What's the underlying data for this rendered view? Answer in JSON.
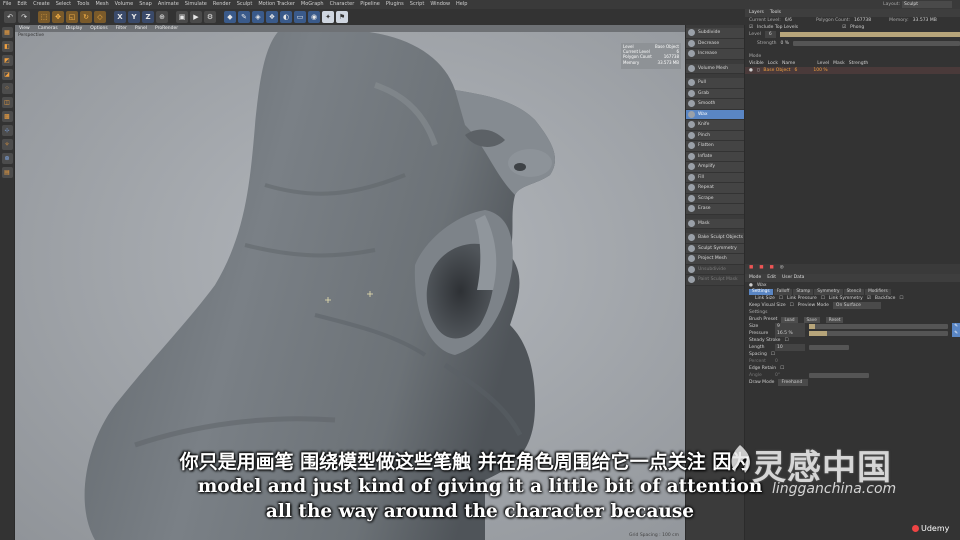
{
  "menubar": {
    "items": [
      "File",
      "Edit",
      "Create",
      "Select",
      "Tools",
      "Mesh",
      "Volume",
      "Snap",
      "Animate",
      "Simulate",
      "Render",
      "Sculpt",
      "Motion Tracker",
      "MoGraph",
      "Character",
      "Pipeline",
      "Plugins",
      "Script",
      "Window",
      "Help"
    ],
    "layout_label": "Layout:",
    "layout_value": "Sculpt"
  },
  "toolbar": {
    "icons": [
      "undo-icon",
      "redo-icon",
      "select-icon",
      "move-icon",
      "scale-icon",
      "rotate-icon",
      "x-axis-icon",
      "y-axis-icon",
      "z-axis-icon",
      "coord-icon",
      "render-region-icon",
      "render-icon",
      "render-settings-icon",
      "cube-icon",
      "pen-icon",
      "subdivide-icon",
      "array-icon",
      "deformer-icon",
      "floor-icon",
      "camera-icon",
      "light-icon",
      "tag-icon"
    ],
    "axis_labels": [
      "X",
      "Y",
      "Z"
    ]
  },
  "viewport": {
    "menu": [
      "View",
      "Cameras",
      "Display",
      "Options",
      "Filter",
      "Panel",
      "ProRender"
    ],
    "camera_label": "Perspective",
    "hud": {
      "level_label": "Level",
      "level_value": "Base Object",
      "current_level_label": "Current Level",
      "current_level_value": "6",
      "polygon_label": "Polygon Count",
      "polygon_value": "167738",
      "memory_label": "Memory",
      "memory_value": "33.573 MB"
    },
    "grid_spacing": "Grid Spacing : 100 cm"
  },
  "sculpt_tools": {
    "top": [
      "Subdivide",
      "Decrease",
      "Increase"
    ],
    "volume_mesh": "Volume Mesh",
    "brushes": [
      "Pull",
      "Grab",
      "Smooth",
      "Wax",
      "Knife",
      "Pinch",
      "Flatten",
      "Inflate",
      "Amplify",
      "Fill",
      "Repeat",
      "Scrape",
      "Erase"
    ],
    "selected_brush": "Wax",
    "mask": "Mask",
    "extras": [
      "Bake Sculpt Objects",
      "Sculpt Symmetry",
      "Project Mesh",
      "Unsubdivide",
      "Paint Sculpt Mask"
    ]
  },
  "layers_panel": {
    "tabs": [
      "Layers",
      "Tools"
    ],
    "current_level_label": "Current Level:",
    "current_level_value": "6/6",
    "polygon_count_label": "Polygon Count:",
    "polygon_count_value": "167738",
    "memory_label": "Memory:",
    "memory_value": "33.573 MB",
    "include_top_levels": "Include Top Levels",
    "phong": "Phong",
    "level_label": "Level",
    "level_value": "6",
    "strength_label": "Strength",
    "strength_value": "0 %",
    "mode_label": "Mode",
    "columns": [
      "Visible",
      "Lock",
      "Name",
      "Level",
      "Mask",
      "Strength"
    ],
    "row": {
      "name": "Base Object",
      "level": "6",
      "strength": "100 %"
    }
  },
  "attributes_panel": {
    "menu": [
      "Mode",
      "Edit",
      "User Data"
    ],
    "tool_name": "Wax",
    "tabs": [
      "Settings",
      "Falloff",
      "Stamp",
      "Symmetry",
      "Stencil",
      "Modifiers"
    ],
    "active_tab": "Settings",
    "link_size": "Link Size",
    "link_pressure": "Link Pressure",
    "link_symmetry": "Link Symmetry",
    "backface": "Backface",
    "keep_visual_size": "Keep Visual Size",
    "preview_mode_label": "Preview Mode",
    "preview_mode_value": "On Surface",
    "section": "Settings",
    "brush_preset_label": "Brush Preset",
    "preset_buttons": [
      "Load",
      "Save",
      "Reset"
    ],
    "size_label": "Size",
    "size_value": "9",
    "pressure_label": "Pressure",
    "pressure_value": "16.5 %",
    "steady_stroke": "Steady Stroke",
    "length_label": "Length",
    "length_value": "10",
    "spacing": "Spacing",
    "percent_label": "Percent",
    "percent_value": "0",
    "edge_retain": "Edge Retain",
    "angle_label": "Angle",
    "angle_value": "0°",
    "draw_mode_label": "Draw Mode",
    "draw_mode_value": "Freehand"
  },
  "subtitles": {
    "cn": "你只是用画笔 围绕模型做这些笔触 并在角色周围给它一点关注 因为",
    "en1": "model and just kind of giving it a little bit of attention",
    "en2": "all the way around the character because"
  },
  "watermark": {
    "cn": "灵感中国",
    "url": "lingganchina.com",
    "udemy": "Udemy"
  },
  "colors": {
    "accent": "#5a86c4",
    "viewport_bg": "#a2a6ab",
    "model": "#6f757a"
  }
}
